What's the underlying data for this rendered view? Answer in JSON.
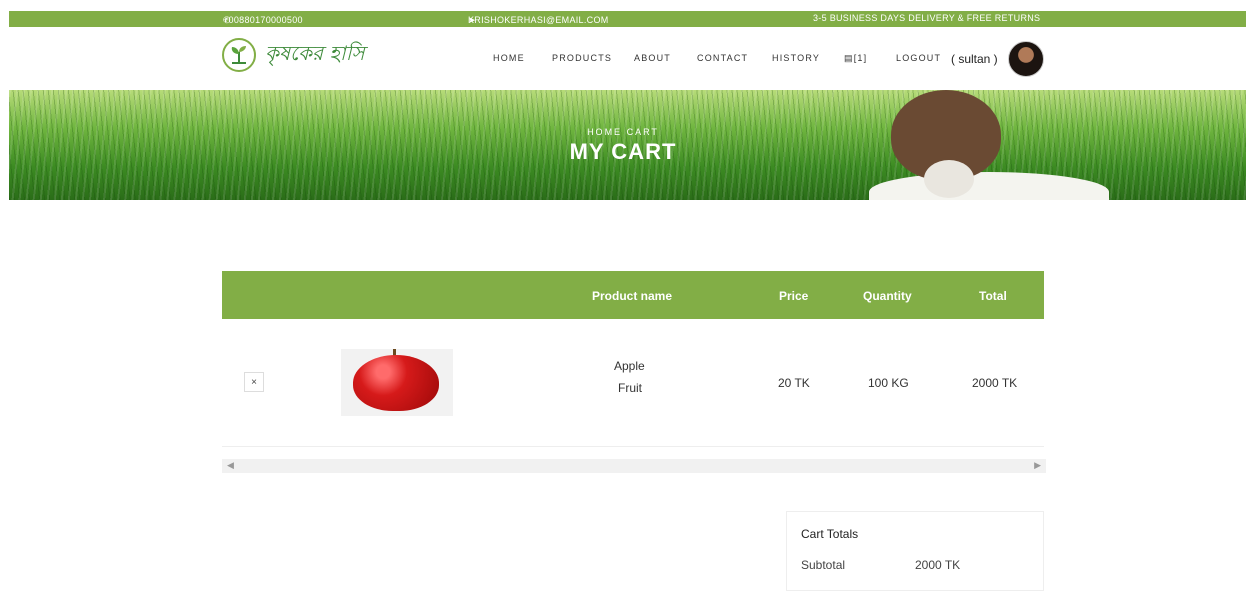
{
  "topbar": {
    "phone": "+00880170000500",
    "email": "KRISHOKERHASI@EMAIL.COM",
    "delivery": "3-5 BUSINESS DAYS DELIVERY & FREE RETURNS"
  },
  "brand": {
    "name": "কৃষকের হাসি"
  },
  "nav": {
    "home": "HOME",
    "products": "PRODUCTS",
    "about": "ABOUT",
    "contact": "CONTACT",
    "history": "HISTORY",
    "cart_count": "[1]",
    "logout": "LOGOUT",
    "user": "( sultan )"
  },
  "hero": {
    "crumb_home": "HOME",
    "crumb_cart": "CART",
    "title": "MY CART"
  },
  "table": {
    "headers": {
      "name": "Product name",
      "price": "Price",
      "quantity": "Quantity",
      "total": "Total"
    },
    "rows": [
      {
        "remove": "×",
        "name": "Apple",
        "category": "Fruit",
        "price": "20 TK",
        "quantity": "100 KG",
        "total": "2000 TK"
      }
    ]
  },
  "totals": {
    "title": "Cart Totals",
    "subtotal_label": "Subtotal",
    "subtotal_value": "2000 TK"
  },
  "colors": {
    "accent": "#82ae46"
  }
}
